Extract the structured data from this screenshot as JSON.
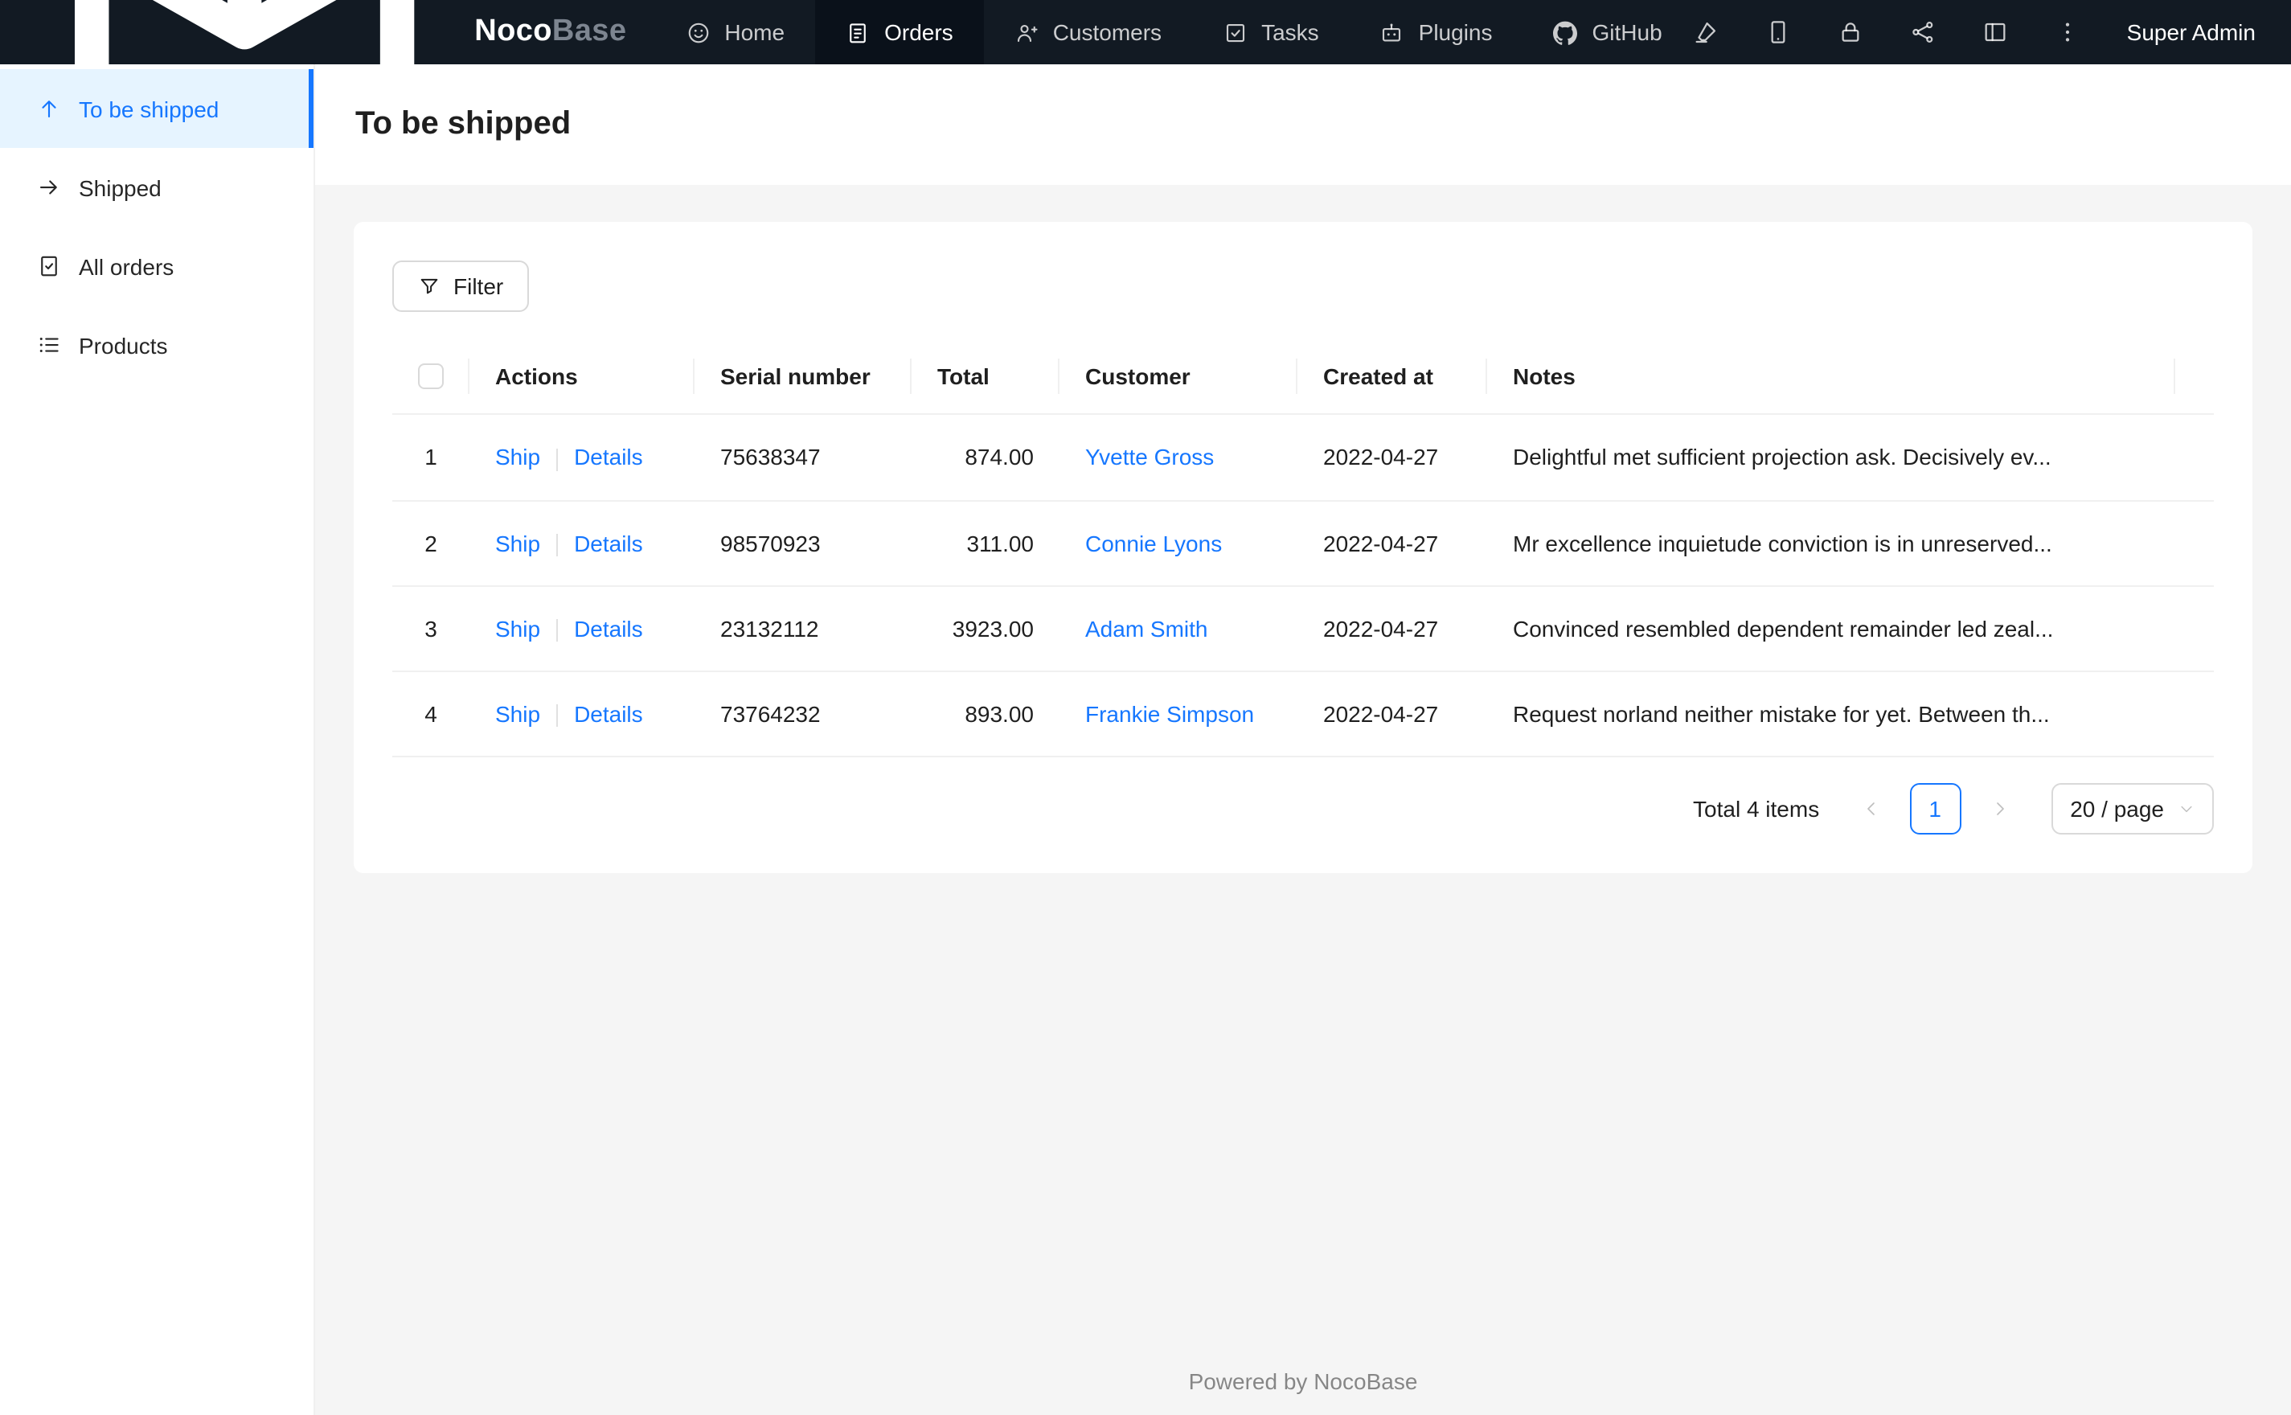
{
  "navbar": {
    "logo_primary": "Noco",
    "logo_secondary": "Base",
    "items": [
      {
        "label": "Home"
      },
      {
        "label": "Orders"
      },
      {
        "label": "Customers"
      },
      {
        "label": "Tasks"
      },
      {
        "label": "Plugins"
      },
      {
        "label": "GitHub"
      }
    ],
    "user": "Super Admin"
  },
  "sidebar": {
    "items": [
      {
        "label": "To be shipped"
      },
      {
        "label": "Shipped"
      },
      {
        "label": "All orders"
      },
      {
        "label": "Products"
      }
    ]
  },
  "page": {
    "title": "To be shipped"
  },
  "toolbar": {
    "filter": "Filter"
  },
  "table": {
    "headers": {
      "actions": "Actions",
      "serial": "Serial number",
      "total": "Total",
      "customer": "Customer",
      "created": "Created at",
      "notes": "Notes"
    },
    "actions": {
      "ship": "Ship",
      "details": "Details"
    },
    "rows": [
      {
        "index": "1",
        "serial": "75638347",
        "total": "874.00",
        "customer": "Yvette Gross",
        "created_at": "2022-04-27",
        "notes": "Delightful met sufficient projection ask. Decisively ev..."
      },
      {
        "index": "2",
        "serial": "98570923",
        "total": "311.00",
        "customer": "Connie Lyons",
        "created_at": "2022-04-27",
        "notes": "Mr excellence inquietude conviction is in unreserved..."
      },
      {
        "index": "3",
        "serial": "23132112",
        "total": "3923.00",
        "customer": "Adam Smith",
        "created_at": "2022-04-27",
        "notes": "Convinced resembled dependent remainder led zeal..."
      },
      {
        "index": "4",
        "serial": "73764232",
        "total": "893.00",
        "customer": "Frankie Simpson",
        "created_at": "2022-04-27",
        "notes": "Request norland neither mistake for yet. Between th..."
      }
    ]
  },
  "pagination": {
    "total": "Total 4 items",
    "page": "1",
    "size": "20 / page"
  },
  "footer": {
    "text": "Powered by NocoBase"
  },
  "colors": {
    "accent": "#1677ff",
    "navbar_bg": "#121a23",
    "navbar_active_bg": "#0a111a",
    "sidebar_active_bg": "#e6f4ff",
    "content_bg": "#f5f5f5"
  }
}
